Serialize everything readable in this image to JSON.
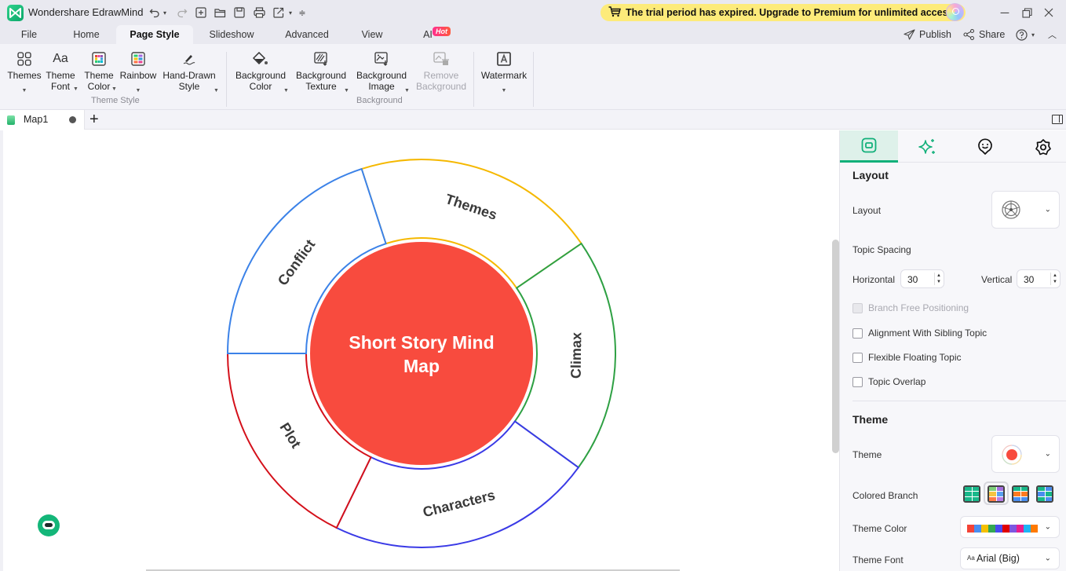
{
  "app": {
    "title": "Wondershare EdrawMind",
    "trial_banner": "The trial period has expired. Upgrade to Premium for unlimited access."
  },
  "quick_access": [
    "undo-icon",
    "redo-icon",
    "new-icon",
    "open-icon",
    "save-icon",
    "print-icon",
    "export-icon",
    "customize-icon"
  ],
  "menu": {
    "tabs": [
      {
        "label": "File"
      },
      {
        "label": "Home"
      },
      {
        "label": "Page Style",
        "active": true
      },
      {
        "label": "Slideshow"
      },
      {
        "label": "Advanced"
      },
      {
        "label": "View"
      },
      {
        "label": "AI",
        "badge": "Hot"
      }
    ],
    "publish": "Publish",
    "share": "Share"
  },
  "ribbon": {
    "groups": [
      {
        "label": "Theme Style",
        "buttons": [
          {
            "line1": "Themes",
            "line2": "",
            "icon": "themes-grid-icon"
          },
          {
            "line1": "Theme",
            "line2": "Font",
            "icon": "theme-font-icon"
          },
          {
            "line1": "Theme",
            "line2": "Color",
            "icon": "theme-color-icon"
          },
          {
            "line1": "Rainbow",
            "line2": "",
            "icon": "rainbow-icon"
          },
          {
            "line1": "Hand-Drawn",
            "line2": "Style",
            "icon": "hand-drawn-icon"
          }
        ]
      },
      {
        "label": "Background",
        "buttons": [
          {
            "line1": "Background",
            "line2": "Color",
            "icon": "paint-bucket-icon"
          },
          {
            "line1": "Background",
            "line2": "Texture",
            "icon": "texture-icon"
          },
          {
            "line1": "Background",
            "line2": "Image",
            "icon": "image-icon"
          },
          {
            "line1": "Remove",
            "line2": "Background",
            "icon": "remove-image-icon",
            "disabled": true
          }
        ]
      },
      {
        "label": "",
        "buttons": [
          {
            "line1": "Watermark",
            "line2": "",
            "icon": "watermark-icon"
          }
        ]
      }
    ]
  },
  "document": {
    "tab_name": "Map1",
    "unsaved": true
  },
  "mindmap": {
    "central_topic": {
      "line1": "Short Story Mind",
      "line2": "Map",
      "color": "#f84b3e"
    },
    "branches": [
      {
        "label": "Themes",
        "color": "#f5b800"
      },
      {
        "label": "Climax",
        "color": "#2ea043"
      },
      {
        "label": "Characters",
        "color": "#3a3ae6"
      },
      {
        "label": "Plot",
        "color": "#d4101a"
      },
      {
        "label": "Conflict",
        "color": "#3b82e8"
      }
    ]
  },
  "panel": {
    "tabs": [
      "format-icon",
      "ai-sparkle-icon",
      "mark-icon",
      "settings-flower-icon"
    ],
    "layout": {
      "heading": "Layout",
      "layout_label": "Layout",
      "topic_spacing_label": "Topic Spacing",
      "horizontal_label": "Horizontal",
      "horizontal_value": "30",
      "vertical_label": "Vertical",
      "vertical_value": "30",
      "checkboxes": [
        {
          "label": "Branch Free Positioning",
          "checked": false,
          "disabled": true
        },
        {
          "label": "Alignment With Sibling Topic",
          "checked": false
        },
        {
          "label": "Flexible Floating Topic",
          "checked": false
        },
        {
          "label": "Topic Overlap",
          "checked": false
        }
      ]
    },
    "theme": {
      "heading": "Theme",
      "theme_label": "Theme",
      "colored_branch_label": "Colored Branch",
      "colored_branch_selected": 1,
      "theme_color_label": "Theme Color",
      "theme_colors": [
        "#f44336",
        "#4a8ef0",
        "#f5c000",
        "#34a853",
        "#4a4af0",
        "#e00000",
        "#7e57e0",
        "#e91e8c",
        "#1eb4f5",
        "#ff7a00"
      ],
      "theme_font_label": "Theme Font",
      "theme_font_value": "Arial (Big)"
    }
  }
}
